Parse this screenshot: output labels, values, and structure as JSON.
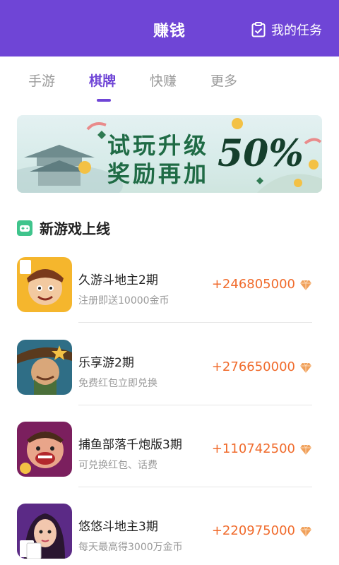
{
  "header": {
    "title": "赚钱",
    "my_task_label": "我的任务"
  },
  "tabs": [
    {
      "label": "手游",
      "active": false
    },
    {
      "label": "棋牌",
      "active": true
    },
    {
      "label": "快赚",
      "active": false
    },
    {
      "label": "更多",
      "active": false
    }
  ],
  "banner": {
    "line1": "试玩升级",
    "line2": "奖励再加",
    "percent": "50%"
  },
  "section": {
    "title": "新游戏上线",
    "icon": "gamepad-icon"
  },
  "games": [
    {
      "name": "久游斗地主2期",
      "desc": "注册即送10000金币",
      "reward": "+246805000"
    },
    {
      "name": "乐享游2期",
      "desc": "免费红包立即兑换",
      "reward": "+276650000"
    },
    {
      "name": "捕鱼部落千炮版3期",
      "desc": "可兑换红包、话费",
      "reward": "+110742500"
    },
    {
      "name": "悠悠斗地主3期",
      "desc": "每天最高得3000万金币",
      "reward": "+220975000"
    }
  ],
  "colors": {
    "brand": "#6f45d6",
    "reward": "#f06b2c",
    "gem": "#f0a05a",
    "section_icon": "#3fc48c"
  }
}
